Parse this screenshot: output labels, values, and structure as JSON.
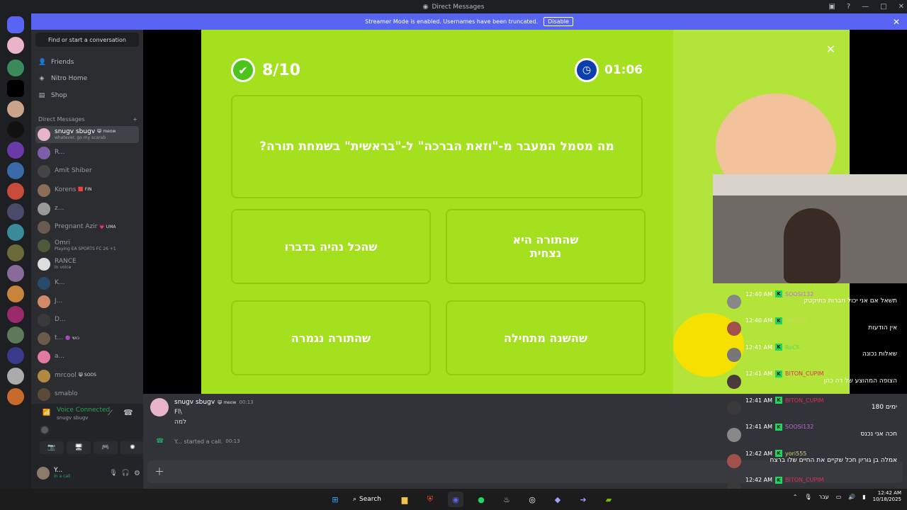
{
  "window": {
    "title": "Direct Messages"
  },
  "banner": {
    "text": "Streamer Mode is enabled. Usernames have been truncated.",
    "disable_label": "Disable"
  },
  "sidebar": {
    "find_placeholder": "Find or start a conversation",
    "nav": [
      {
        "label": "Friends",
        "icon": "friends-icon"
      },
      {
        "label": "Nitro Home",
        "icon": "nitro-icon"
      },
      {
        "label": "Shop",
        "icon": "shop-icon"
      }
    ],
    "dm_header": "Direct Messages",
    "add_dm": "+",
    "dms": [
      {
        "name": "snugv sbugv",
        "tag": "😸 meow",
        "sub": "whatever. go my scarab",
        "color": "#e8b4c8",
        "selected": true
      },
      {
        "name": "R...",
        "tag": "",
        "sub": "",
        "color": "#7d5ea8"
      },
      {
        "name": "Amit Shiber",
        "tag": "",
        "sub": "",
        "color": "#444"
      },
      {
        "name": "Korens",
        "tag": "🟥 FIN",
        "sub": "",
        "color": "#8a6d57"
      },
      {
        "name": "z...",
        "tag": "",
        "sub": "",
        "color": "#9a9a9a"
      },
      {
        "name": "Pregnant Azir",
        "tag": "💗 UMA",
        "sub": "",
        "color": "#6b5a4e"
      },
      {
        "name": "Omri",
        "tag": "",
        "sub": "Playing EA SPORTS FC 26 +1",
        "color": "#4a5a3a"
      },
      {
        "name": "RANCE",
        "tag": "",
        "sub": "In voice",
        "color": "#ddd"
      },
      {
        "name": "K...",
        "tag": "",
        "sub": "",
        "color": "#2a4a6a"
      },
      {
        "name": "J...",
        "tag": "",
        "sub": "",
        "color": "#d08a6a"
      },
      {
        "name": "D...",
        "tag": "",
        "sub": "",
        "color": "#3a3a3a"
      },
      {
        "name": "t...",
        "tag": "🟣 כושי",
        "sub": "",
        "color": "#6a5a4a"
      },
      {
        "name": "a...",
        "tag": "",
        "sub": "",
        "color": "#e07aa0"
      },
      {
        "name": "mrcool",
        "tag": "😸 SOOS",
        "sub": "",
        "color": "#b08a40"
      },
      {
        "name": "smablo",
        "tag": "",
        "sub": "",
        "color": "#5a4a3a"
      }
    ]
  },
  "voice": {
    "title": "Voice Connected",
    "sub": "snugv sbugv"
  },
  "user": {
    "name": "Y...",
    "status": "In a call"
  },
  "game": {
    "score": "8/10",
    "timer": "01:06",
    "close": "✕",
    "question": "מה מסמל המעבר מ-\"וזאת הברכה\" ל-\"בראשית\" בשמחת תורה?",
    "answers": [
      "שהתורה היא\nנצחית",
      "שהכל נהיה בדברו",
      "שהשנה מתחילה",
      "שהתורה נגמרה"
    ]
  },
  "chat": {
    "messages": [
      {
        "author": "snugv sbugv",
        "tag": "😸 meow",
        "time": "00:13",
        "lines": [
          "Fl\\",
          "למה"
        ]
      },
      {
        "system": "Y... started a call.",
        "time": "00:13"
      }
    ],
    "input_placeholder": ""
  },
  "twitch_chat": [
    {
      "time": "12:40 AM",
      "user": "SOOSI132",
      "color": "#c36bd6",
      "text": "תשאל אם אני יכול חברות בתיקטק"
    },
    {
      "time": "12:40 AM",
      "user": "yori555",
      "color": "#d4d46b",
      "text": "אין הודעות"
    },
    {
      "time": "12:41 AM",
      "user": "RoCK",
      "color": "#5bd75b",
      "text": "שאלות נכונה"
    },
    {
      "time": "12:41 AM",
      "user": "BITON_CUPIM",
      "color": "#e0314b",
      "text": "הצופה המהוצע של דה כהן"
    },
    {
      "time": "12:41 AM",
      "user": "BITON_CUPIM",
      "color": "#e0314b",
      "text": "ימים 180"
    },
    {
      "time": "12:41 AM",
      "user": "SOOSI132",
      "color": "#c36bd6",
      "text": "חכה אני נכנס"
    },
    {
      "time": "12:42 AM",
      "user": "yori555",
      "color": "#d4d46b",
      "text": "אמלה בן גוריון חכל שקיים את החיים שלו ברצח"
    },
    {
      "time": "12:42 AM",
      "user": "BITON_CUPIM",
      "color": "#e0314b",
      "text": ""
    }
  ],
  "taskbar": {
    "search": "Search",
    "lang": "עבר",
    "time": "12:42 AM",
    "date": "10/18/2025"
  }
}
